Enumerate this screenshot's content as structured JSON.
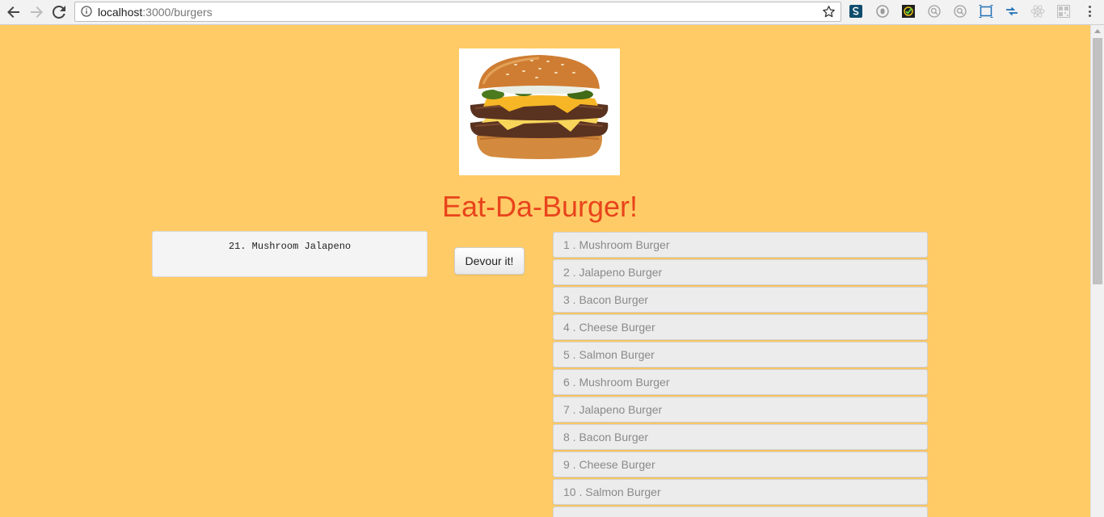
{
  "browser": {
    "url_host": "localhost",
    "url_path": ":3000/burgers",
    "extensions": [
      "stylus-icon",
      "ghostery-icon",
      "checklist-icon",
      "zoom-icon",
      "zoom-icon-2",
      "window-icon",
      "sync-icon",
      "react-icon",
      "qr-icon"
    ]
  },
  "page": {
    "background": "#ffcb66",
    "title": "Eat-Da-Burger!",
    "title_color": "#e8441c",
    "hero_image": "burger-image"
  },
  "pending": {
    "items": [
      "21. Mushroom Jalapeno"
    ]
  },
  "devour_button": "Devour it!",
  "burgers": [
    "1 . Mushroom Burger",
    "2 . Jalapeno Burger",
    "3 . Bacon Burger",
    "4 . Cheese Burger",
    "5 . Salmon Burger",
    "6 . Mushroom Burger",
    "7 . Jalapeno Burger",
    "8 . Bacon Burger",
    "9 . Cheese Burger",
    "10 . Salmon Burger"
  ]
}
